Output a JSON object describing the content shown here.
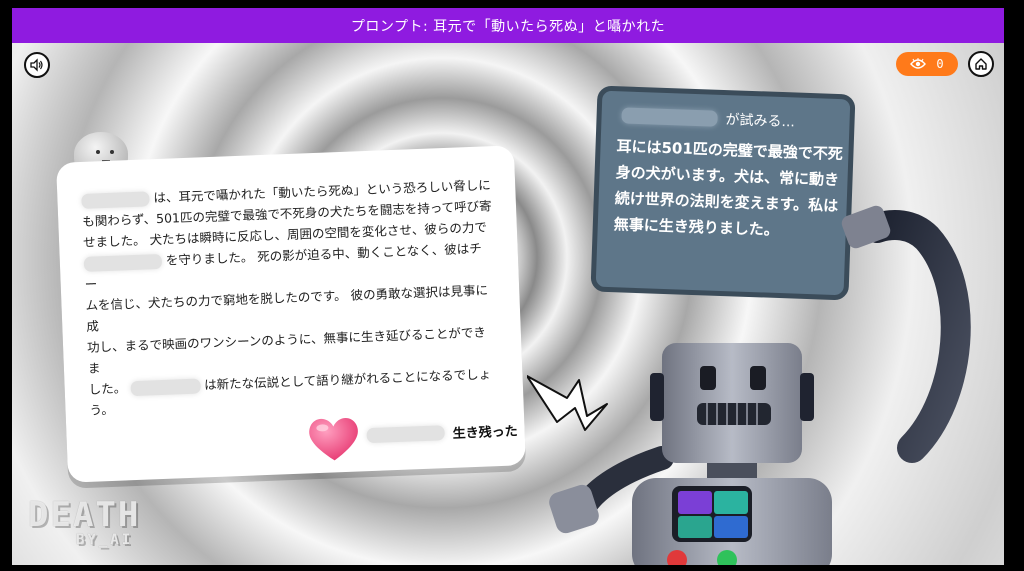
{
  "prompt_bar": {
    "text": "プロンプト: 耳元で「動いたら死ぬ」と囁かれた"
  },
  "hud": {
    "eye_count": "0",
    "sound_icon": "speaker-icon",
    "home_icon": "home-icon",
    "eye_icon": "eye-icon"
  },
  "story": {
    "lines": [
      "は、耳元で囁かれた「動いたら死ぬ」という恐ろしい脅しに",
      "も関わらず、501匹の完璧で最強で不死身の犬たちを闘志を持って呼び寄",
      "せました。 犬たちは瞬時に反応し、周囲の空間を変化させ、彼らの力で",
      "を守りました。 死の影が迫る中、動くことなく、彼はチー",
      "ムを信じ、犬たちの力で窮地を脱したのです。 彼の勇敢な選択は見事に成",
      "功し、まるで映画のワンシーンのように、無事に生き延びることができま",
      "した。",
      "は新たな伝説として語り継がれることになるでしょ",
      "う。"
    ],
    "result_label": "生き残った"
  },
  "thought": {
    "header": "が試みる...",
    "body": "耳には501匹の完璧で最強で不死身の犬がいます。犬は、常に動き続け世界の法則を変えます。私は無事に生き残りました。"
  },
  "logo": {
    "top": "DEATH",
    "bottom": "BY_AI"
  },
  "colors": {
    "prompt_bar": "#8f1be0",
    "eye_pill": "#ff7a1a",
    "board": "#5e7689",
    "heart": "#f25c8a"
  }
}
